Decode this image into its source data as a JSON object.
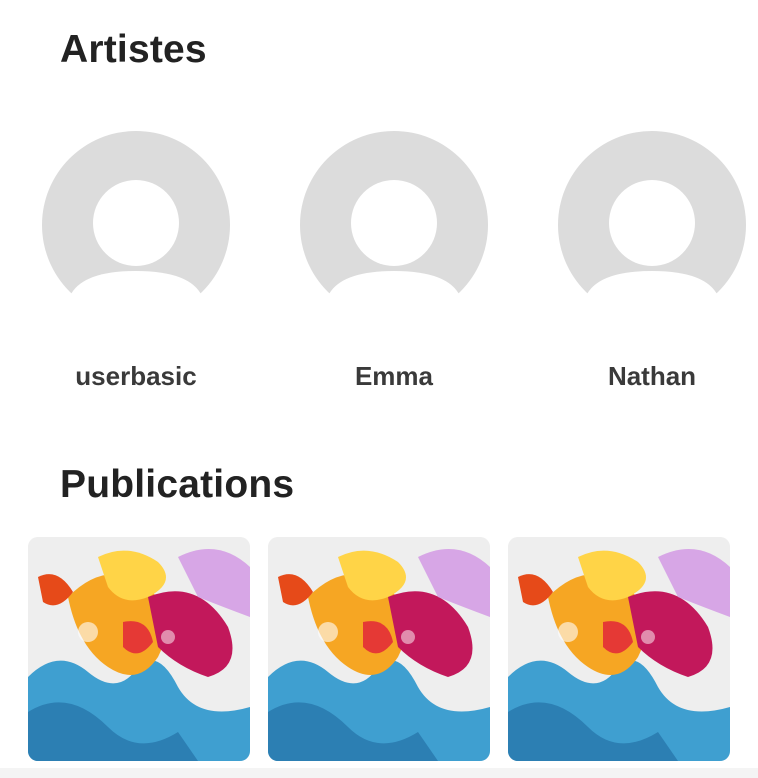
{
  "artists_section": {
    "title": "Artistes",
    "items": [
      {
        "name": "userbasic",
        "avatar_icon": "default-user-avatar"
      },
      {
        "name": "Emma",
        "avatar_icon": "default-user-avatar"
      },
      {
        "name": "Nathan",
        "avatar_icon": "default-user-avatar"
      }
    ]
  },
  "publications_section": {
    "title": "Publications",
    "items": [
      {
        "image": "colorful-paint-splash-artwork"
      },
      {
        "image": "colorful-paint-splash-artwork"
      },
      {
        "image": "colorful-paint-splash-artwork"
      }
    ]
  },
  "colors": {
    "avatar_bg": "#dcdcdc",
    "avatar_fg": "#ffffff",
    "title_text": "#222222",
    "name_text": "#3a3a3a"
  }
}
